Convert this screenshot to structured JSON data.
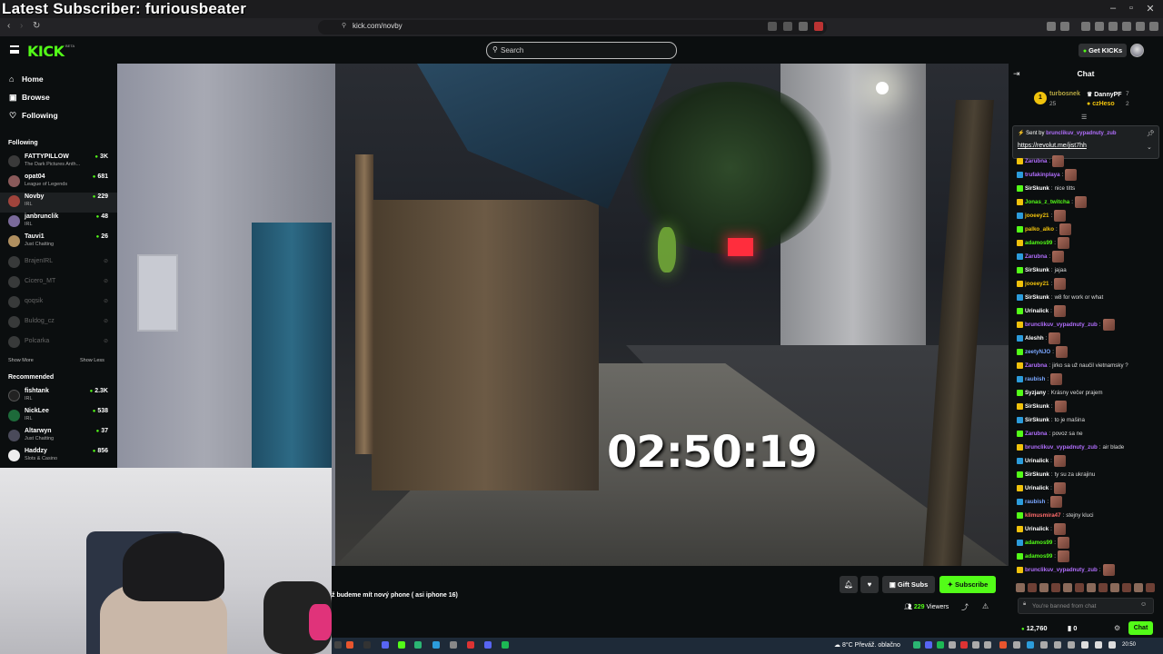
{
  "overlay": {
    "latest_subscriber": "Latest Subscriber: furiousbeater"
  },
  "browser": {
    "url": "kick.com/novby"
  },
  "header": {
    "logo": "KICK",
    "logo_tag": "BETA",
    "search_placeholder": "Search",
    "get_kicks": "Get KICKs"
  },
  "sidebar": {
    "nav": [
      {
        "label": "Home",
        "icon": "home-icon"
      },
      {
        "label": "Browse",
        "icon": "browse-icon"
      },
      {
        "label": "Following",
        "icon": "heart-icon"
      }
    ],
    "following_heading": "Following",
    "following": [
      {
        "name": "FATTYPILLOW",
        "sub": "The Dark Pictures Anth...",
        "count": "3K"
      },
      {
        "name": "opat04",
        "sub": "League of Legends",
        "count": "681"
      },
      {
        "name": "Novby",
        "sub": "IRL",
        "count": "229"
      },
      {
        "name": "janbrunclik",
        "sub": "IRL",
        "count": "48"
      },
      {
        "name": "Tauvi1",
        "sub": "Just Chatting",
        "count": "26"
      }
    ],
    "offline": [
      "BrajenIRL",
      "Cicero_MT",
      "qoqsik",
      "Buldog_cz",
      "Polcarka"
    ],
    "show_more": "Show More",
    "show_less": "Show Less",
    "recommended_heading": "Recommended",
    "recommended": [
      {
        "name": "fishtank",
        "sub": "IRL",
        "count": "2.3K"
      },
      {
        "name": "NickLee",
        "sub": "IRL",
        "count": "538"
      },
      {
        "name": "Altarwyn",
        "sub": "Just Chatting",
        "count": "37"
      },
      {
        "name": "Haddzy",
        "sub": "Slots & Casino",
        "count": "856"
      }
    ]
  },
  "video": {
    "timer": "02:50:19"
  },
  "stream": {
    "title": "ž budeme mít nový phone ( asi iphone 16)",
    "gift_subs": "Gift Subs",
    "subscribe": "Subscribe",
    "viewers_count": "229",
    "viewers_label": "Viewers"
  },
  "taskbar": {
    "weather": "8°C  Převáž. oblačno",
    "time": "20:50"
  },
  "chat": {
    "title": "Chat",
    "leaderboard": [
      {
        "rank": "1",
        "name": "turbosnek",
        "value": "25"
      },
      {
        "name": "DannyPF",
        "value": "7"
      },
      {
        "name": "czHeso",
        "value": "2"
      }
    ],
    "pinned_by_prefix": "Sent by",
    "pinned_by_user": "brunclikuv_vypadnuty_zub",
    "pinned_message": "https://revolut.me/jist7hh",
    "messages": [
      {
        "user": "Zarubna",
        "color": "#b16efd",
        "text": ""
      },
      {
        "user": "trufakinplaya",
        "color": "#b16efd",
        "text": ""
      },
      {
        "user": "SirSkunk",
        "color": "#ffffff",
        "text": "nice titts"
      },
      {
        "user": "Jonas_z_twitcha",
        "color": "#53fc18",
        "text": ""
      },
      {
        "user": "jooeey21",
        "color": "#f0c20c",
        "text": ""
      },
      {
        "user": "palko_alko",
        "color": "#f0c20c",
        "text": ""
      },
      {
        "user": "adamos99",
        "color": "#53fc18",
        "text": ""
      },
      {
        "user": "Zarubna",
        "color": "#b16efd",
        "text": ""
      },
      {
        "user": "SirSkunk",
        "color": "#ffffff",
        "text": "jajaa"
      },
      {
        "user": "jooeey21",
        "color": "#f0c20c",
        "text": ""
      },
      {
        "user": "SirSkunk",
        "color": "#ffffff",
        "text": "w8 for work or what"
      },
      {
        "user": "Urinalick",
        "color": "#ffffff",
        "text": ""
      },
      {
        "user": "brunclikuv_vypadnuty_zub",
        "color": "#b16efd",
        "text": ""
      },
      {
        "user": "Aleshh",
        "color": "#ffffff",
        "text": ""
      },
      {
        "user": "zeetyNJO",
        "color": "#7aa7ff",
        "text": ""
      },
      {
        "user": "Zarubna",
        "color": "#b16efd",
        "text": "jirko sa už naučil vietnamsky ?"
      },
      {
        "user": "raubish",
        "color": "#7aa7ff",
        "text": ""
      },
      {
        "user": "Syzjany",
        "color": "#ffffff",
        "text": "Krásny večer prajem"
      },
      {
        "user": "SirSkunk",
        "color": "#ffffff",
        "text": ""
      },
      {
        "user": "SirSkunk",
        "color": "#ffffff",
        "text": "to je mašina"
      },
      {
        "user": "Zarubna",
        "color": "#b16efd",
        "text": "povoz sa ne"
      },
      {
        "user": "brunclikuv_vypadnuty_zub",
        "color": "#b16efd",
        "text": "air blade"
      },
      {
        "user": "Urinalick",
        "color": "#ffffff",
        "text": ""
      },
      {
        "user": "SirSkunk",
        "color": "#ffffff",
        "text": "ty su za ukrajinu"
      },
      {
        "user": "Urinalick",
        "color": "#ffffff",
        "text": ""
      },
      {
        "user": "raubish",
        "color": "#7aa7ff",
        "text": ""
      },
      {
        "user": "klimusmira47",
        "color": "#ff6b6b",
        "text": "stejny kluci"
      },
      {
        "user": "Urinalick",
        "color": "#ffffff",
        "text": ""
      },
      {
        "user": "adamos99",
        "color": "#53fc18",
        "text": ""
      },
      {
        "user": "adamos99",
        "color": "#53fc18",
        "text": ""
      },
      {
        "user": "brunclikuv_vypadnuty_zub",
        "color": "#b16efd",
        "text": ""
      }
    ],
    "input_placeholder": "You're banned from chat",
    "kicks": "12,760",
    "points": "0",
    "send": "Chat"
  },
  "colors": {
    "brand": "#53fc18",
    "background": "#0b0e0f",
    "panel": "#2f3133"
  }
}
